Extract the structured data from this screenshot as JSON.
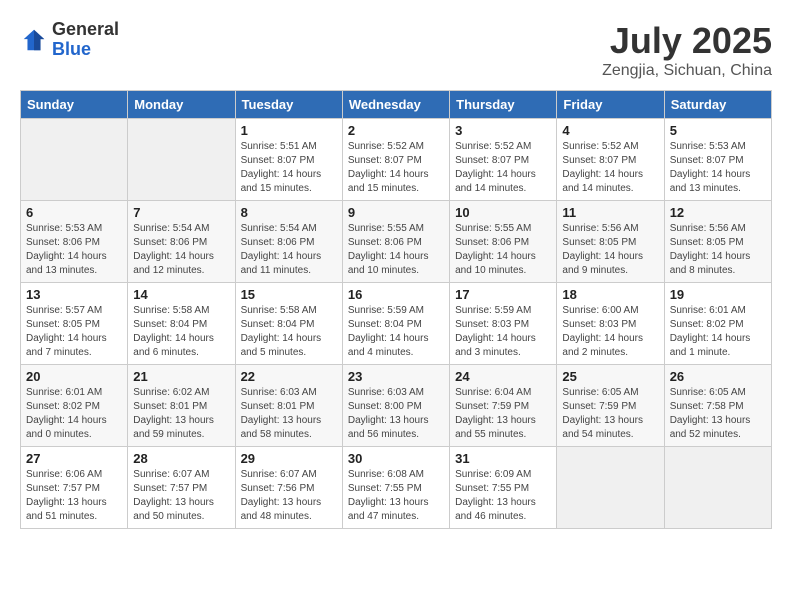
{
  "header": {
    "logo_general": "General",
    "logo_blue": "Blue",
    "month_year": "July 2025",
    "location": "Zengjia, Sichuan, China"
  },
  "weekdays": [
    "Sunday",
    "Monday",
    "Tuesday",
    "Wednesday",
    "Thursday",
    "Friday",
    "Saturday"
  ],
  "weeks": [
    [
      {
        "day": "",
        "info": ""
      },
      {
        "day": "",
        "info": ""
      },
      {
        "day": "1",
        "info": "Sunrise: 5:51 AM\nSunset: 8:07 PM\nDaylight: 14 hours and 15 minutes."
      },
      {
        "day": "2",
        "info": "Sunrise: 5:52 AM\nSunset: 8:07 PM\nDaylight: 14 hours and 15 minutes."
      },
      {
        "day": "3",
        "info": "Sunrise: 5:52 AM\nSunset: 8:07 PM\nDaylight: 14 hours and 14 minutes."
      },
      {
        "day": "4",
        "info": "Sunrise: 5:52 AM\nSunset: 8:07 PM\nDaylight: 14 hours and 14 minutes."
      },
      {
        "day": "5",
        "info": "Sunrise: 5:53 AM\nSunset: 8:07 PM\nDaylight: 14 hours and 13 minutes."
      }
    ],
    [
      {
        "day": "6",
        "info": "Sunrise: 5:53 AM\nSunset: 8:06 PM\nDaylight: 14 hours and 13 minutes."
      },
      {
        "day": "7",
        "info": "Sunrise: 5:54 AM\nSunset: 8:06 PM\nDaylight: 14 hours and 12 minutes."
      },
      {
        "day": "8",
        "info": "Sunrise: 5:54 AM\nSunset: 8:06 PM\nDaylight: 14 hours and 11 minutes."
      },
      {
        "day": "9",
        "info": "Sunrise: 5:55 AM\nSunset: 8:06 PM\nDaylight: 14 hours and 10 minutes."
      },
      {
        "day": "10",
        "info": "Sunrise: 5:55 AM\nSunset: 8:06 PM\nDaylight: 14 hours and 10 minutes."
      },
      {
        "day": "11",
        "info": "Sunrise: 5:56 AM\nSunset: 8:05 PM\nDaylight: 14 hours and 9 minutes."
      },
      {
        "day": "12",
        "info": "Sunrise: 5:56 AM\nSunset: 8:05 PM\nDaylight: 14 hours and 8 minutes."
      }
    ],
    [
      {
        "day": "13",
        "info": "Sunrise: 5:57 AM\nSunset: 8:05 PM\nDaylight: 14 hours and 7 minutes."
      },
      {
        "day": "14",
        "info": "Sunrise: 5:58 AM\nSunset: 8:04 PM\nDaylight: 14 hours and 6 minutes."
      },
      {
        "day": "15",
        "info": "Sunrise: 5:58 AM\nSunset: 8:04 PM\nDaylight: 14 hours and 5 minutes."
      },
      {
        "day": "16",
        "info": "Sunrise: 5:59 AM\nSunset: 8:04 PM\nDaylight: 14 hours and 4 minutes."
      },
      {
        "day": "17",
        "info": "Sunrise: 5:59 AM\nSunset: 8:03 PM\nDaylight: 14 hours and 3 minutes."
      },
      {
        "day": "18",
        "info": "Sunrise: 6:00 AM\nSunset: 8:03 PM\nDaylight: 14 hours and 2 minutes."
      },
      {
        "day": "19",
        "info": "Sunrise: 6:01 AM\nSunset: 8:02 PM\nDaylight: 14 hours and 1 minute."
      }
    ],
    [
      {
        "day": "20",
        "info": "Sunrise: 6:01 AM\nSunset: 8:02 PM\nDaylight: 14 hours and 0 minutes."
      },
      {
        "day": "21",
        "info": "Sunrise: 6:02 AM\nSunset: 8:01 PM\nDaylight: 13 hours and 59 minutes."
      },
      {
        "day": "22",
        "info": "Sunrise: 6:03 AM\nSunset: 8:01 PM\nDaylight: 13 hours and 58 minutes."
      },
      {
        "day": "23",
        "info": "Sunrise: 6:03 AM\nSunset: 8:00 PM\nDaylight: 13 hours and 56 minutes."
      },
      {
        "day": "24",
        "info": "Sunrise: 6:04 AM\nSunset: 7:59 PM\nDaylight: 13 hours and 55 minutes."
      },
      {
        "day": "25",
        "info": "Sunrise: 6:05 AM\nSunset: 7:59 PM\nDaylight: 13 hours and 54 minutes."
      },
      {
        "day": "26",
        "info": "Sunrise: 6:05 AM\nSunset: 7:58 PM\nDaylight: 13 hours and 52 minutes."
      }
    ],
    [
      {
        "day": "27",
        "info": "Sunrise: 6:06 AM\nSunset: 7:57 PM\nDaylight: 13 hours and 51 minutes."
      },
      {
        "day": "28",
        "info": "Sunrise: 6:07 AM\nSunset: 7:57 PM\nDaylight: 13 hours and 50 minutes."
      },
      {
        "day": "29",
        "info": "Sunrise: 6:07 AM\nSunset: 7:56 PM\nDaylight: 13 hours and 48 minutes."
      },
      {
        "day": "30",
        "info": "Sunrise: 6:08 AM\nSunset: 7:55 PM\nDaylight: 13 hours and 47 minutes."
      },
      {
        "day": "31",
        "info": "Sunrise: 6:09 AM\nSunset: 7:55 PM\nDaylight: 13 hours and 46 minutes."
      },
      {
        "day": "",
        "info": ""
      },
      {
        "day": "",
        "info": ""
      }
    ]
  ]
}
